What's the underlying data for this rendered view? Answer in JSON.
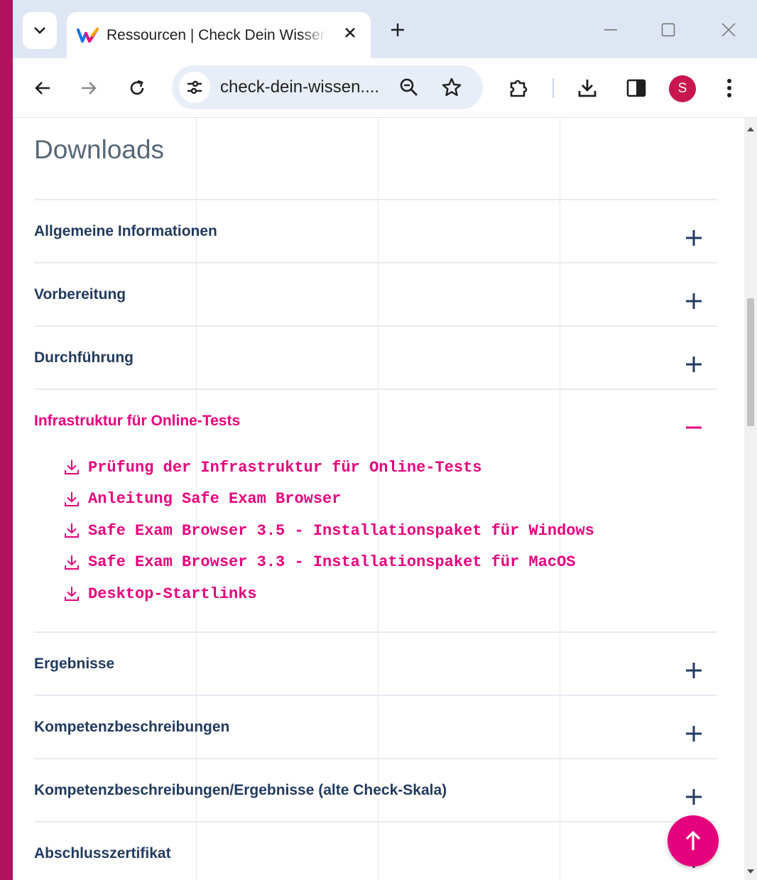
{
  "browser": {
    "tab": {
      "title": "Ressourcen | Check Dein Wissen",
      "favicon": "check-dein-wissen-logo"
    },
    "url": "check-dein-wissen....",
    "profile_initial": "S"
  },
  "page": {
    "heading": "Downloads",
    "sections": [
      {
        "title": "Allgemeine Informationen",
        "expanded": false
      },
      {
        "title": "Vorbereitung",
        "expanded": false
      },
      {
        "title": "Durchführung",
        "expanded": false
      },
      {
        "title": "Infrastruktur für Online-Tests",
        "expanded": true,
        "links": [
          "Prüfung der Infrastruktur für Online-Tests",
          "Anleitung Safe Exam Browser",
          "Safe Exam Browser 3.5 - Installationspaket für Windows",
          "Safe Exam Browser 3.3 - Installationspaket für MacOS",
          "Desktop-Startlinks"
        ]
      },
      {
        "title": "Ergebnisse",
        "expanded": false
      },
      {
        "title": "Kompetenzbeschreibungen",
        "expanded": false
      },
      {
        "title": "Kompetenzbeschreibungen/Ergebnisse (alte Check-Skala)",
        "expanded": false
      },
      {
        "title": "Abschlusszertifikat",
        "expanded": false
      }
    ]
  },
  "colors": {
    "accent": "#e5007d",
    "heading_text": "#223a5e",
    "window_frame": "#b0125f",
    "avatar": "#c8174e"
  },
  "icons": {
    "tab_search": "chevron-down-icon",
    "tab_close": "close-icon",
    "new_tab": "plus-icon",
    "back": "arrow-left-icon",
    "forward": "arrow-right-icon",
    "reload": "reload-icon",
    "site_info": "tune-icon",
    "zoom": "zoom-out-icon",
    "bookmark": "star-icon",
    "extensions": "puzzle-icon",
    "downloads": "download-icon",
    "side_panel": "side-panel-icon",
    "menu": "kebab-menu-icon",
    "collapsed": "plus-icon",
    "expanded": "minus-icon",
    "link": "download-icon",
    "back_to_top": "arrow-up-icon"
  }
}
